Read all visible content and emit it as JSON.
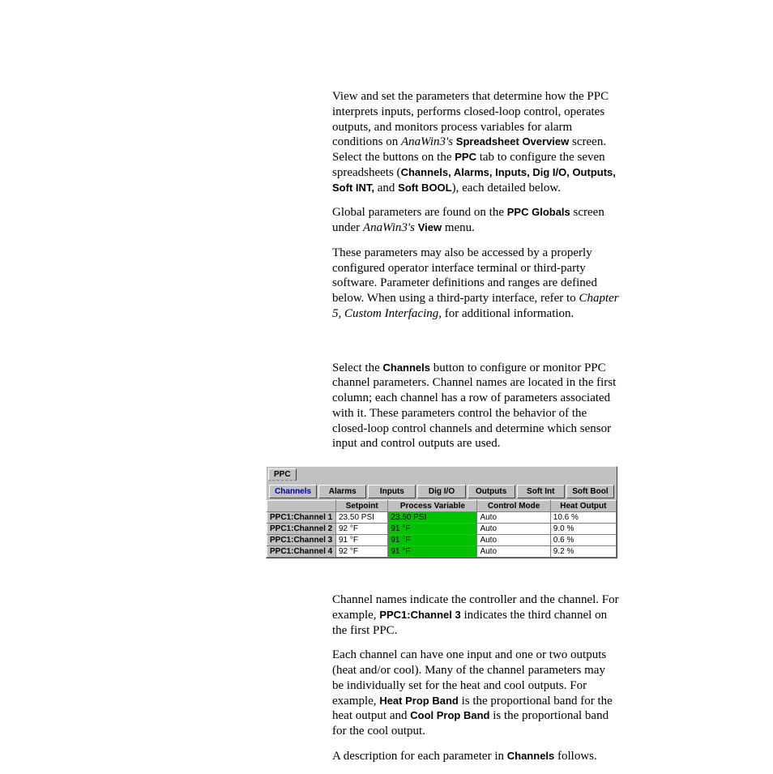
{
  "intro": {
    "p1_pre": "View and set the parameters that determine how the PPC interprets inputs, performs closed-loop control, operates outputs, and monitors process variables for alarm conditions on ",
    "p1_i1": "AnaWin3's",
    "p1_mid1": " ",
    "p1_b1": "Spreadsheet Overview",
    "p1_mid2": " screen. Select the buttons on the ",
    "p1_b2": "PPC",
    "p1_mid3": " tab to configure the seven spreadsheets (",
    "p1_b3": "Channels, Alarms, Inputs, Dig I/O, Outputs, Soft INT,",
    "p1_mid4": " and ",
    "p1_b4": "Soft BOOL",
    "p1_post": "), each detailed below.",
    "p2_pre": "Global parameters are found on the ",
    "p2_b1": "PPC Globals",
    "p2_mid": " screen under ",
    "p2_i1": "AnaWin3's",
    "p2_sp": " ",
    "p2_b2": "View",
    "p2_post": " menu.",
    "p3_pre": "These parameters may also be accessed by a properly configured operator interface terminal or third-party software. Parameter definitions and ranges are defined below. When using a third-party interface, refer to ",
    "p3_i1": "Chapter 5, Custom Interfacing,",
    "p3_post": " for additional information."
  },
  "channels_intro": {
    "pre": "Select the ",
    "b1": "Channels",
    "post": " button to configure or monitor PPC channel parameters. Channel names are located in the first column; each channel has a row of parameters associated with it. These parameters control the behavior of the closed-loop control channels and determine which sensor input and control outputs are used."
  },
  "figure": {
    "tab": "PPC",
    "buttons": [
      "Channels",
      "Alarms",
      "Inputs",
      "Dig I/O",
      "Outputs",
      "Soft Int",
      "Soft Bool"
    ],
    "active_button": 0,
    "columns": [
      "Setpoint",
      "Process Variable",
      "Control Mode",
      "Heat Output"
    ],
    "rows": [
      {
        "name": "PPC1:Channel 1",
        "setpoint": "23.50 PSI",
        "pv": "23.50 PSI",
        "mode": "Auto",
        "heat": "10.6 %"
      },
      {
        "name": "PPC1:Channel 2",
        "setpoint": "92   °F",
        "pv": "91   °F",
        "mode": "Auto",
        "heat": "9.0 %"
      },
      {
        "name": "PPC1:Channel 3",
        "setpoint": "91   °F",
        "pv": "91   °F",
        "mode": "Auto",
        "heat": "0.6 %"
      },
      {
        "name": "PPC1:Channel 4",
        "setpoint": "92   °F",
        "pv": "91   °F",
        "mode": "Auto",
        "heat": "9.2 %"
      }
    ]
  },
  "below": {
    "p1_pre": "Channel names indicate the controller and the channel. For example, ",
    "p1_b1": "PPC1:Channel 3",
    "p1_post": " indicates the third channel on the first PPC.",
    "p2_pre": "Each channel can have one input and one or two outputs (heat and/or cool). Many of the channel parameters may be individually set for the heat and cool outputs. For example, ",
    "p2_b1": "Heat Prop Band",
    "p2_mid1": " is the proportional band for the heat output and ",
    "p2_b2": "Cool Prop Band",
    "p2_post": " is the proportional band for the cool output.",
    "p3_pre": "A description for each parameter in ",
    "p3_b1": "Channels",
    "p3_post": " follows."
  }
}
